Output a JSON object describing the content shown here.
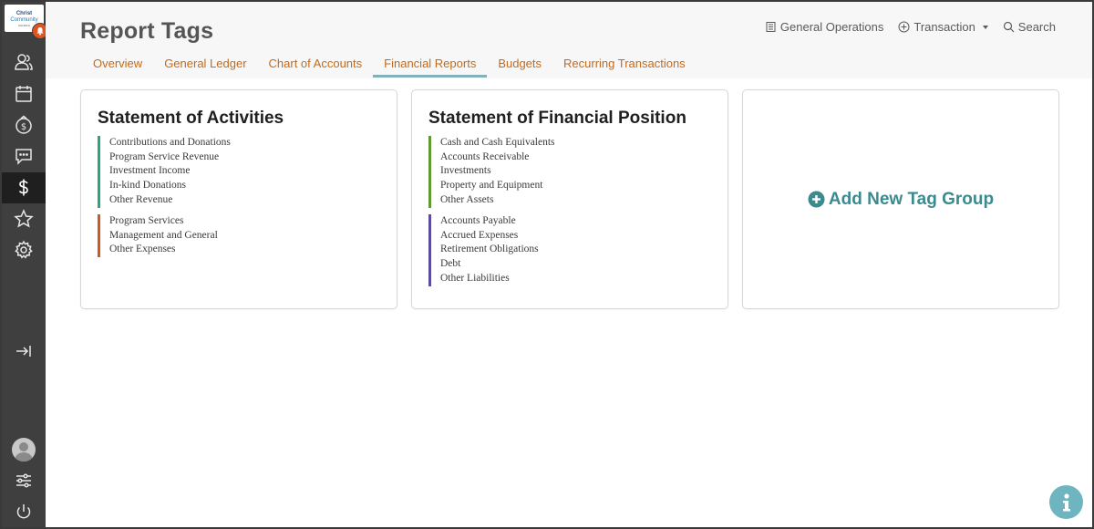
{
  "logo": {
    "line1": "Christ",
    "line2": "Community",
    "line3": "CHURCH"
  },
  "header": {
    "title": "Report Tags",
    "actions": {
      "general_operations": "General Operations",
      "transaction": "Transaction",
      "search": "Search"
    }
  },
  "tabs": [
    {
      "label": "Overview"
    },
    {
      "label": "General Ledger"
    },
    {
      "label": "Chart of Accounts"
    },
    {
      "label": "Financial Reports",
      "active": true
    },
    {
      "label": "Budgets"
    },
    {
      "label": "Recurring Transactions"
    }
  ],
  "cards": {
    "activities": {
      "title": "Statement of Activities",
      "groups": [
        {
          "color": "#2aa87d",
          "items": [
            "Contributions and Donations",
            "Program Service Revenue",
            "Investment Income",
            "In-kind Donations",
            "Other Revenue"
          ]
        },
        {
          "color": "#d2591e",
          "items": [
            "Program Services",
            "Management and General",
            "Other Expenses"
          ]
        }
      ]
    },
    "position": {
      "title": "Statement of Financial Position",
      "groups": [
        {
          "color": "#5f9b2e",
          "items": [
            "Cash and Cash Equivalents",
            "Accounts Receivable",
            "Investments",
            "Property and Equipment",
            "Other Assets"
          ]
        },
        {
          "color": "#5c4c9c",
          "items": [
            "Accounts Payable",
            "Accrued Expenses",
            "Retirement Obligations",
            "Debt",
            "Other Liabilities"
          ]
        }
      ]
    },
    "add": {
      "label": "Add New Tag Group"
    }
  },
  "colors": {
    "accent_tab": "#c46a1a",
    "tab_underline": "#7fb2bd",
    "add_group": "#3b8a8e",
    "notification": "#e0551f",
    "sidebar": "#3f3f3f"
  }
}
